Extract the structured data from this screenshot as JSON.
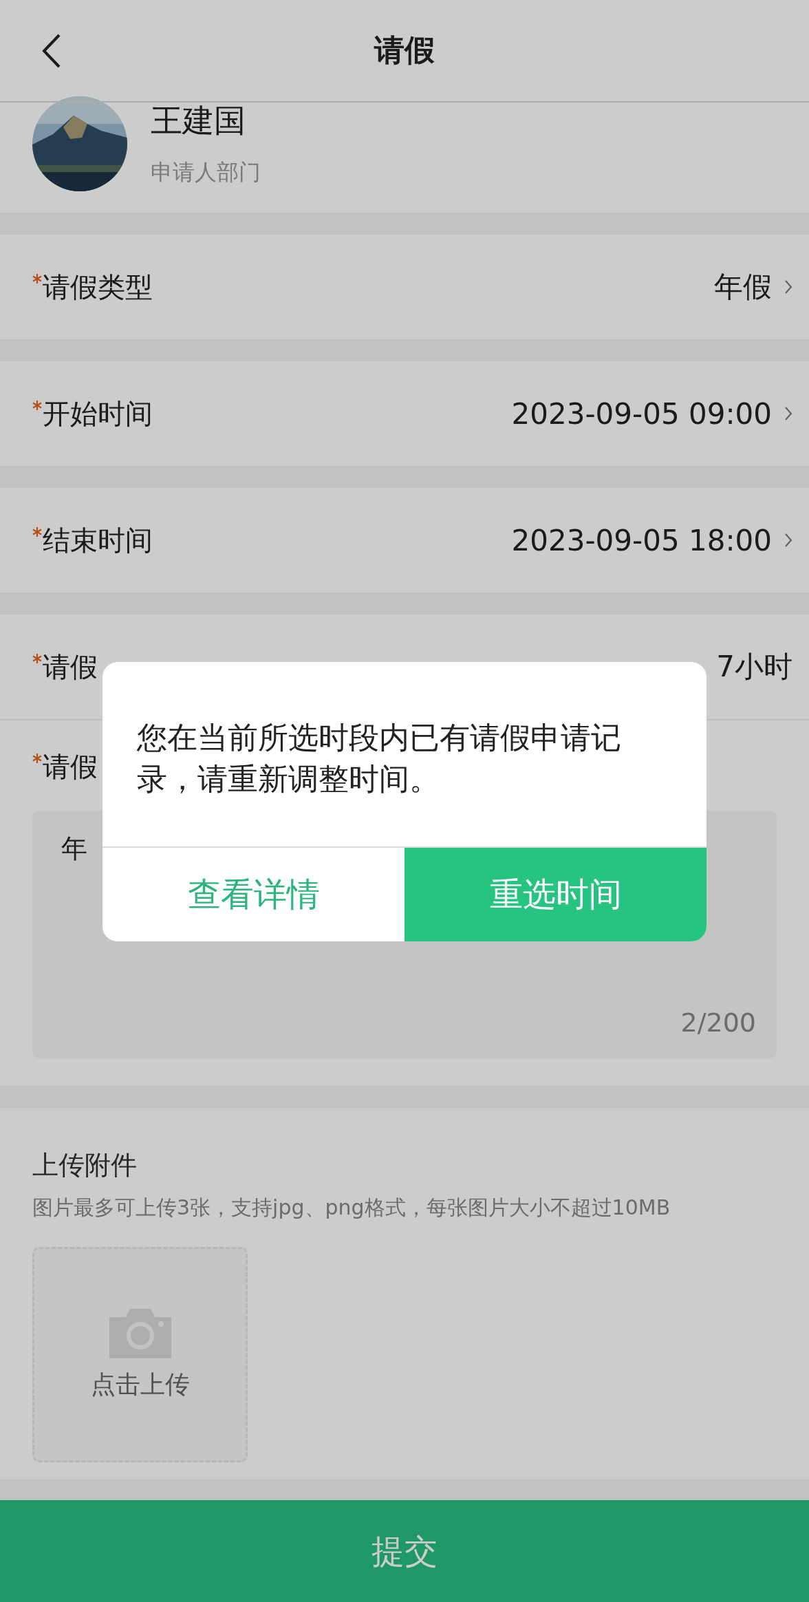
{
  "header": {
    "title": "请假"
  },
  "applicant": {
    "name": "王建国",
    "department": "申请人部门"
  },
  "fields": [
    {
      "label": "请假类型",
      "required": true,
      "value": "年假",
      "kind": "select"
    },
    {
      "label": "开始时间",
      "required": true,
      "value": "2023-09-05 09:00",
      "kind": "select"
    },
    {
      "label": "结束时间",
      "required": true,
      "value": "2023-09-05 18:00",
      "kind": "select"
    },
    {
      "label": "请假",
      "required": true,
      "value": "7小时",
      "kind": "display"
    }
  ],
  "reason": {
    "label": "请假",
    "required": true,
    "text": "年",
    "counter": "2/200"
  },
  "attachments": {
    "title": "上传附件",
    "hint": "图片最多可上传3张，支持jpg、png格式，每张图片大小不超过10MB",
    "upload_label": "点击上传"
  },
  "submit": "提交",
  "dialog": {
    "message": "您在当前所选时段内已有请假申请记录，请重新调整时间。",
    "buttons": [
      {
        "label": "查看详情",
        "kind": "secondary"
      },
      {
        "label": "重选时间",
        "kind": "primary"
      }
    ]
  }
}
